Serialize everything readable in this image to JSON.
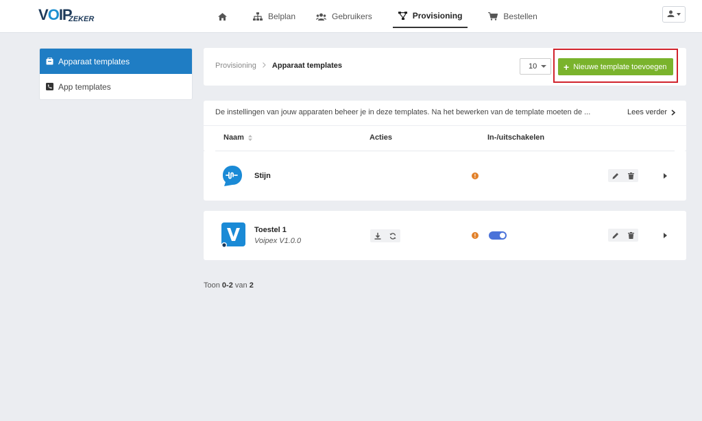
{
  "brand": {
    "logo_main": "VOIP",
    "logo_sub": "ZEKER"
  },
  "nav": {
    "home_icon": "home-icon",
    "items": [
      {
        "label": "Belplan",
        "icon": "sitemap-icon"
      },
      {
        "label": "Gebruikers",
        "icon": "users-icon"
      },
      {
        "label": "Provisioning",
        "icon": "network-icon",
        "active": true
      },
      {
        "label": "Bestellen",
        "icon": "cart-icon"
      }
    ],
    "user_icon": "user-icon"
  },
  "sidebar": {
    "items": [
      {
        "label": "Apparaat templates",
        "icon": "folder-icon",
        "active": true
      },
      {
        "label": "App templates",
        "icon": "phone-square-icon"
      }
    ]
  },
  "header": {
    "breadcrumb": [
      "Provisioning",
      "Apparaat templates"
    ],
    "page_size": "10",
    "add_button": "Nieuwe template toevoegen"
  },
  "list": {
    "info": "De instellingen van jouw apparaten beheer je in deze templates. Na het bewerken van de template moeten de ...",
    "read_more": "Lees verder",
    "columns": [
      "Naam",
      "Acties",
      "In-/uitschakelen"
    ],
    "rows": [
      {
        "name": "Stijn",
        "subtitle": "",
        "enabled": null
      },
      {
        "name": "Toestel 1",
        "subtitle": "Voipex V1.0.0",
        "enabled": true
      }
    ]
  },
  "pager": {
    "prefix": "Toon",
    "range": "0-2",
    "mid": "van",
    "total": "2"
  },
  "colors": {
    "primary": "#1f7dc4",
    "success": "#7ab32c",
    "warning": "#e2812a",
    "highlight": "#d0212a",
    "toggle": "#4a72d9"
  }
}
